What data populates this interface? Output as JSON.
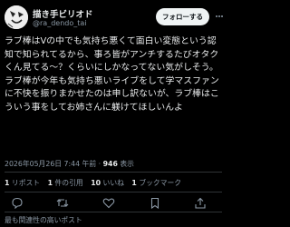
{
  "author": {
    "name": "描き手ビリオド",
    "handle": "@ra_dendo_tai"
  },
  "header": {
    "follow_label": "フォローする"
  },
  "tweet": {
    "text_1": "ラブ棒はVの中でも気持ち悪くて面白い変態という認知で知られてるから、事ろ皆がアンチするたびオタクくん見てる〜？くらいにしかなってない気がしそう。",
    "text_2": "ラブ棒が今年も気持ち悪いライブをして学マスファンに不快を振りまかせたのは申し訳ないが、ラブ棒はこういう事をしてお姉さんに躾けてほしいんよ",
    "date": "2026年05月26日 7:44 午前",
    "separator": "·",
    "views_count": "946",
    "views_label": "表示"
  },
  "stats": {
    "retweets_count": "1",
    "retweets_label": "リポスト",
    "quotes_count": "1",
    "quotes_label": "件の引用",
    "likes_count": "10",
    "likes_label": "いいね",
    "bookmarks_count": "1",
    "bookmarks_label": "ブックマーク"
  },
  "actions": [
    "reply-icon",
    "retweet-icon",
    "like-icon",
    "bookmark-icon",
    "share-icon"
  ],
  "related_label": "最も関連性の高いポスト",
  "colors": {
    "background": "#000000",
    "text": "#e7e9ea",
    "muted": "#8b98a5",
    "divider": "#2f3336",
    "button": "#eff3f4"
  }
}
